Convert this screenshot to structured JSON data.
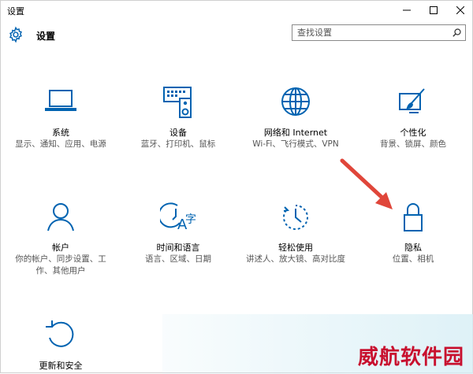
{
  "window": {
    "title": "设置"
  },
  "header": {
    "title": "设置"
  },
  "search": {
    "placeholder": "查找设置"
  },
  "tiles": [
    {
      "id": "system",
      "name": "系统",
      "desc": "显示、通知、应用、电源",
      "icon": "laptop-icon"
    },
    {
      "id": "devices",
      "name": "设备",
      "desc": "蓝牙、打印机、鼠标",
      "icon": "devices-icon"
    },
    {
      "id": "network",
      "name": "网络和 Internet",
      "desc": "Wi-Fi、飞行模式、VPN",
      "icon": "globe-icon"
    },
    {
      "id": "personalization",
      "name": "个性化",
      "desc": "背景、锁屏、颜色",
      "icon": "paint-icon"
    },
    {
      "id": "accounts",
      "name": "帐户",
      "desc": "你的帐户、同步设置、工作、其他用户",
      "icon": "person-icon"
    },
    {
      "id": "time",
      "name": "时间和语言",
      "desc": "语言、区域、日期",
      "icon": "time-language-icon"
    },
    {
      "id": "ease",
      "name": "轻松使用",
      "desc": "讲述人、放大镜、高对比度",
      "icon": "ease-of-access-icon"
    },
    {
      "id": "privacy",
      "name": "隐私",
      "desc": "位置、相机",
      "icon": "lock-icon"
    },
    {
      "id": "update",
      "name": "更新和安全",
      "desc": "",
      "icon": "update-icon"
    }
  ],
  "watermark": "威航软件园",
  "colors": {
    "accent": "#0063b1",
    "arrow": "#e0463a",
    "watermark": "#c8102e"
  }
}
